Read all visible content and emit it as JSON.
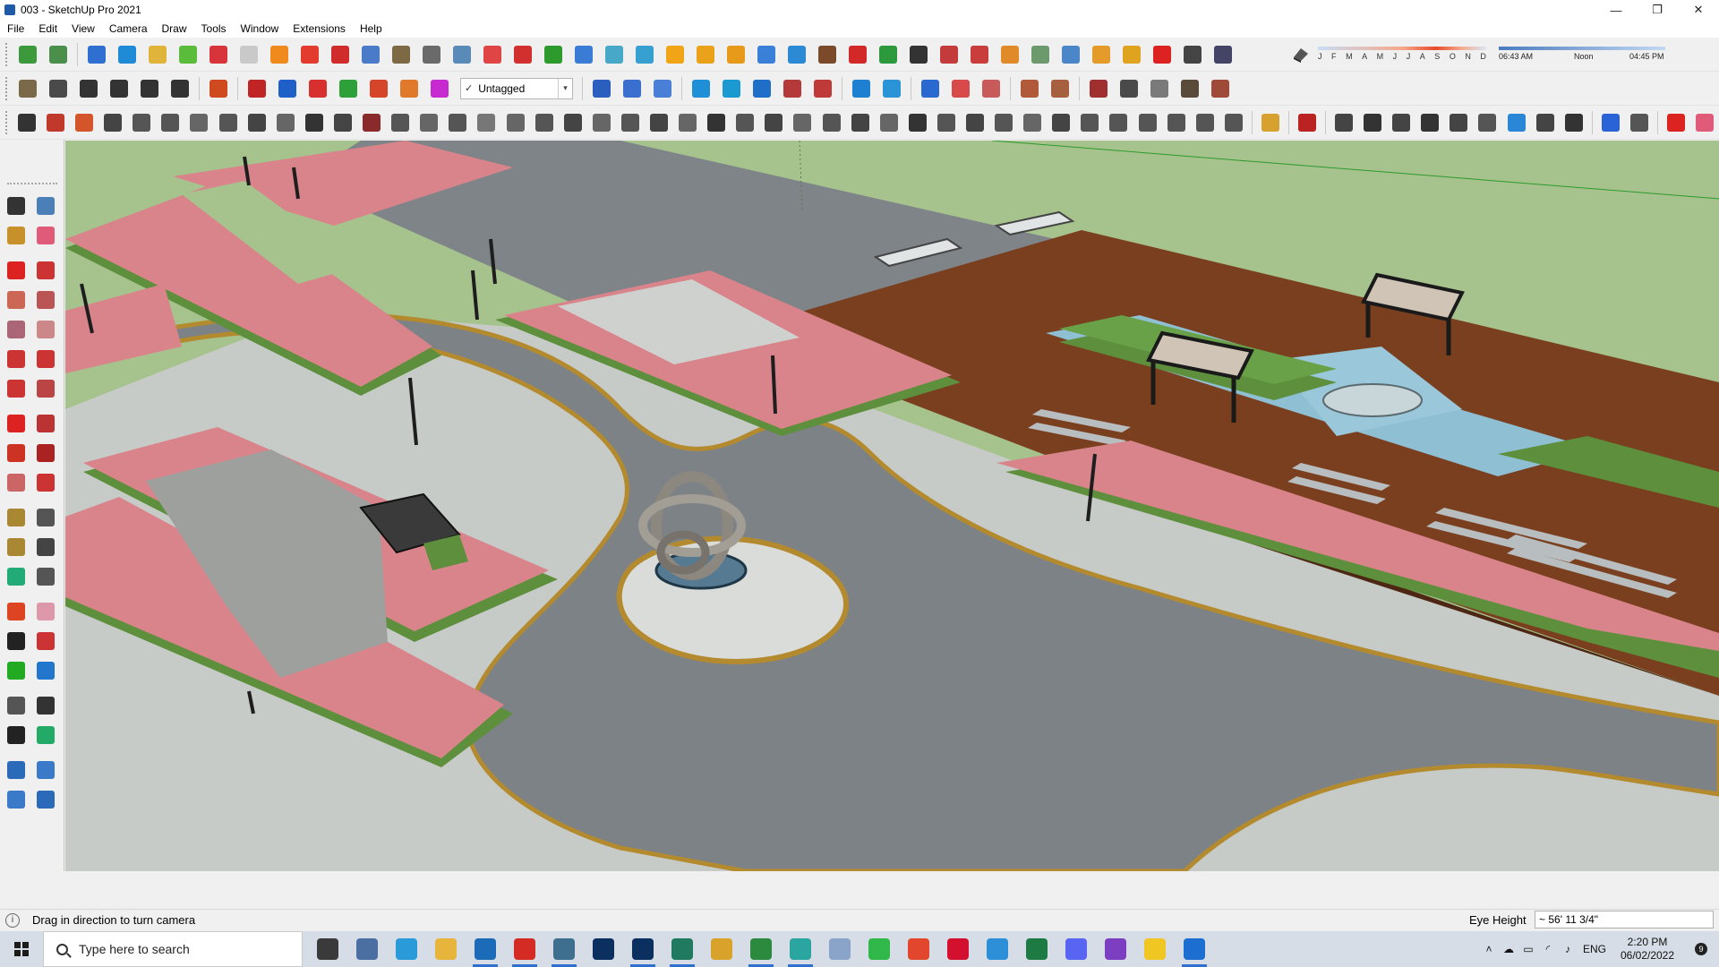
{
  "window": {
    "title": "003 - SketchUp Pro 2021",
    "min": "—",
    "max": "❐",
    "close": "✕"
  },
  "menu": [
    "File",
    "Edit",
    "View",
    "Camera",
    "Draw",
    "Tools",
    "Window",
    "Extensions",
    "Help"
  ],
  "layer": {
    "check": "✓",
    "value": "Untagged",
    "arrow": "▾"
  },
  "shadow": {
    "months": [
      "J",
      "F",
      "M",
      "A",
      "M",
      "J",
      "J",
      "A",
      "S",
      "O",
      "N",
      "D"
    ],
    "time_start": "06:43 AM",
    "time_mid": "Noon",
    "time_end": "04:45 PM"
  },
  "status": {
    "info_icon": "i",
    "message": "Drag in direction to turn camera",
    "measure_label": "Eye Height",
    "measure_value": "~ 56' 11 3/4\""
  },
  "taskbar": {
    "search_placeholder": "Type here to search",
    "lang": "ENG",
    "time": "2:20 PM",
    "date": "06/02/2022",
    "notifications": "9",
    "apps": [
      {
        "name": "task-view",
        "color": "#3a3a3a"
      },
      {
        "name": "calculator",
        "color": "#4a6fa0"
      },
      {
        "name": "edge",
        "color": "#2a9bd8"
      },
      {
        "name": "file-explorer",
        "color": "#e8b53c"
      },
      {
        "name": "sketchup",
        "color": "#1b6bb8",
        "active": true
      },
      {
        "name": "acrobat",
        "color": "#d42c25",
        "active": true
      },
      {
        "name": "app-frame",
        "color": "#3e6f8f",
        "active": true
      },
      {
        "name": "photoshop-1",
        "color": "#0b2f5f"
      },
      {
        "name": "photoshop-2",
        "color": "#0b2f5f",
        "active": true
      },
      {
        "name": "app-green",
        "color": "#1f7a5f",
        "active": true
      },
      {
        "name": "chrome",
        "color": "#d9a22a"
      },
      {
        "name": "chrome-2",
        "color": "#2b8a3e",
        "active": true
      },
      {
        "name": "app-teal",
        "color": "#2aa5a0",
        "active": true
      },
      {
        "name": "notes",
        "color": "#8aa3c8"
      },
      {
        "name": "whatsapp",
        "color": "#31b84a"
      },
      {
        "name": "brave",
        "color": "#e2462c"
      },
      {
        "name": "opera",
        "color": "#d3112e"
      },
      {
        "name": "vscode",
        "color": "#2d8fd8"
      },
      {
        "name": "excel",
        "color": "#1d7a43"
      },
      {
        "name": "discord",
        "color": "#5865f2"
      },
      {
        "name": "podcast",
        "color": "#7d3fc1"
      },
      {
        "name": "sticky-notes",
        "color": "#f0c623"
      },
      {
        "name": "photos",
        "color": "#1c6fd0",
        "active": true
      }
    ]
  },
  "colors": {
    "grass": "#a6c38e",
    "pink": "#d9848a",
    "paving": "#c9ccc8",
    "asphalt": "#7d8287",
    "curb": "#b48a2e",
    "deck": "#7a3f1f",
    "water": "#8fbfd3"
  }
}
